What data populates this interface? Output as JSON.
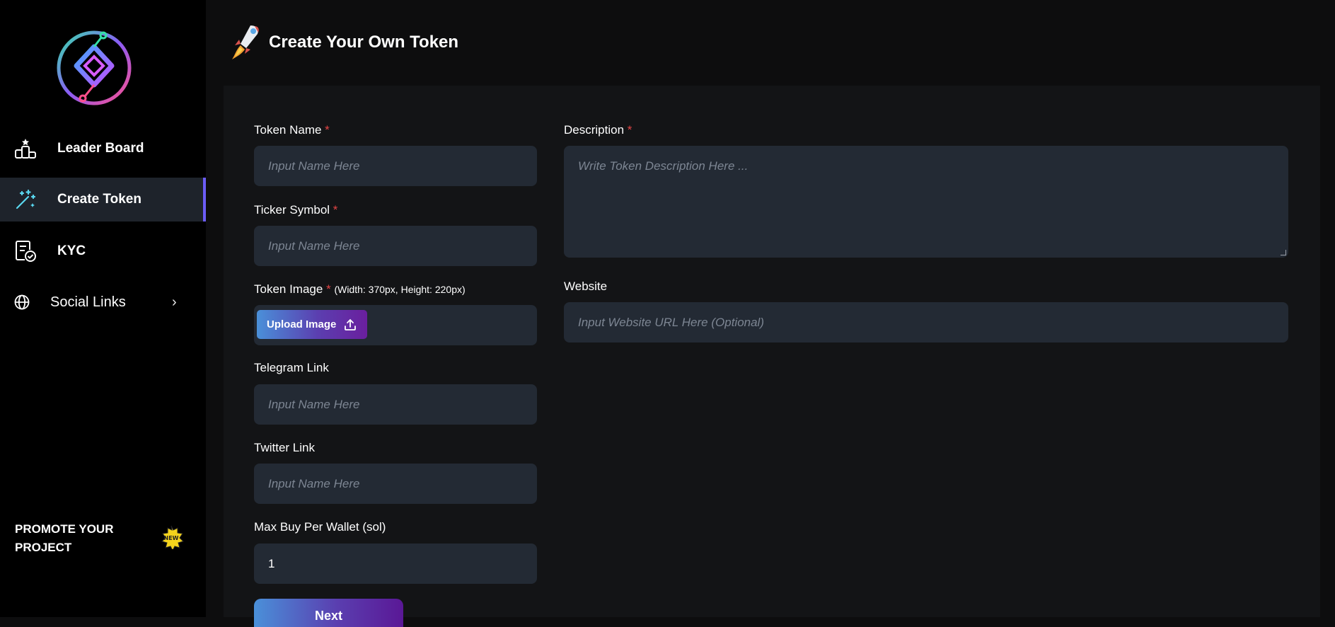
{
  "sidebar": {
    "nav": [
      {
        "label": "Leader Board",
        "icon": "leaderboard-icon"
      },
      {
        "label": "Create Token",
        "icon": "magic-wand-icon",
        "active": true
      },
      {
        "label": "KYC",
        "icon": "document-check-icon"
      },
      {
        "label": "Social Links",
        "icon": "globe-icon"
      }
    ],
    "promo_text": "PROMOTE YOUR PROJECT",
    "promo_badge_icon": "new-badge-icon"
  },
  "header": {
    "title": "Create Your Own Token",
    "icon": "rocket-icon"
  },
  "form": {
    "token_name": {
      "label": "Token Name",
      "required": "*",
      "placeholder": "Input Name Here"
    },
    "ticker_symbol": {
      "label": "Ticker Symbol",
      "required": "*",
      "placeholder": "Input Name Here"
    },
    "token_image": {
      "label": "Token Image",
      "required": "*",
      "hint": "(Width: 370px, Height: 220px)",
      "button": "Upload Image"
    },
    "telegram": {
      "label": "Telegram Link",
      "placeholder": "Input Name Here"
    },
    "twitter": {
      "label": "Twitter Link",
      "placeholder": "Input Name Here"
    },
    "max_buy": {
      "label": "Max Buy Per Wallet (sol)",
      "value": "1"
    },
    "description": {
      "label": "Description",
      "required": "*",
      "placeholder": "Write Token Description Here ..."
    },
    "website": {
      "label": "Website",
      "placeholder": "Input Website URL Here (Optional)"
    },
    "next_button": "Next"
  },
  "colors": {
    "accent": "#6b5cf6",
    "required": "#e24545",
    "input_bg": "#232a34",
    "active_nav_bg": "#1e232b"
  }
}
